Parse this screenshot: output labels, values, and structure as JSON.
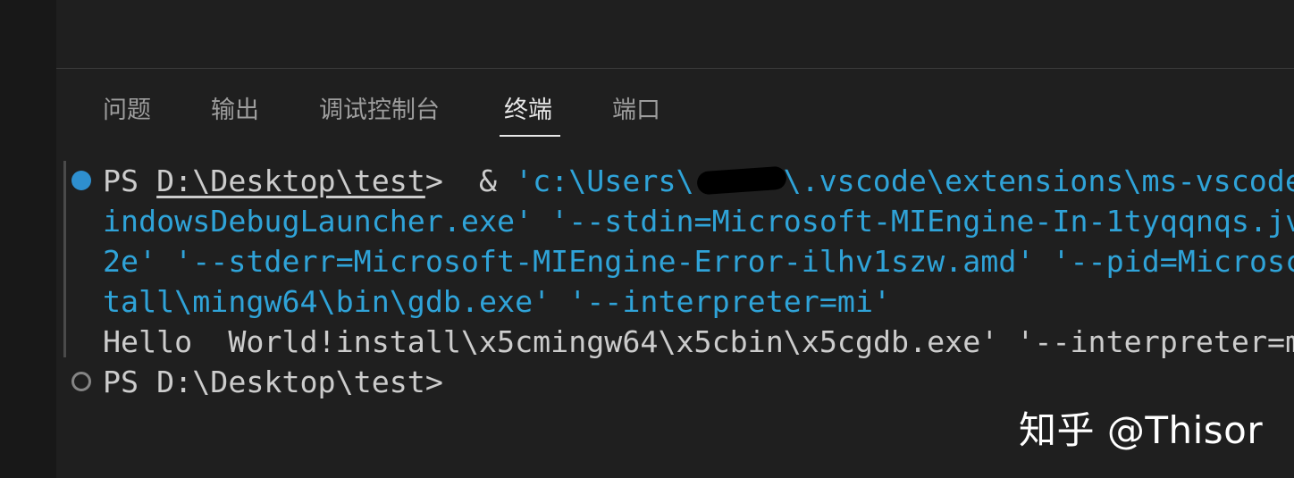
{
  "panel": {
    "tabs": [
      {
        "label": "问题"
      },
      {
        "label": "输出"
      },
      {
        "label": "调试控制台"
      },
      {
        "label": "终端",
        "active": true
      },
      {
        "label": "端口"
      }
    ]
  },
  "terminal": {
    "lines": [
      {
        "prompt": "PS ",
        "path": "D:\\Desktop\\test",
        "prompt_end": ">  & ",
        "cmd_start": "'c:\\Users\\",
        "cmd_after_redact": "\\.vscode\\extensions\\ms-vscode"
      },
      {
        "text": "indowsDebugLauncher.exe' '--stdin=Microsoft-MIEngine-In-1tyqqnqs.jv"
      },
      {
        "text": "2e' '--stderr=Microsoft-MIEngine-Error-ilhv1szw.amd' '--pid=Microsc"
      },
      {
        "text": "tall\\mingw64\\bin\\gdb.exe' '--interpreter=mi'"
      },
      {
        "text": "Hello  World!install\\x5cmingw64\\x5cbin\\x5cgdb.exe' '--interpreter=m"
      },
      {
        "text": "PS D:\\Desktop\\test>"
      }
    ]
  },
  "watermark": {
    "text": "知乎 @Thisor"
  },
  "colors": {
    "background": "#1f1f1f",
    "string": "#2fa3d8",
    "text": "#cccccc",
    "success_decoration": "#2e8fcf"
  }
}
